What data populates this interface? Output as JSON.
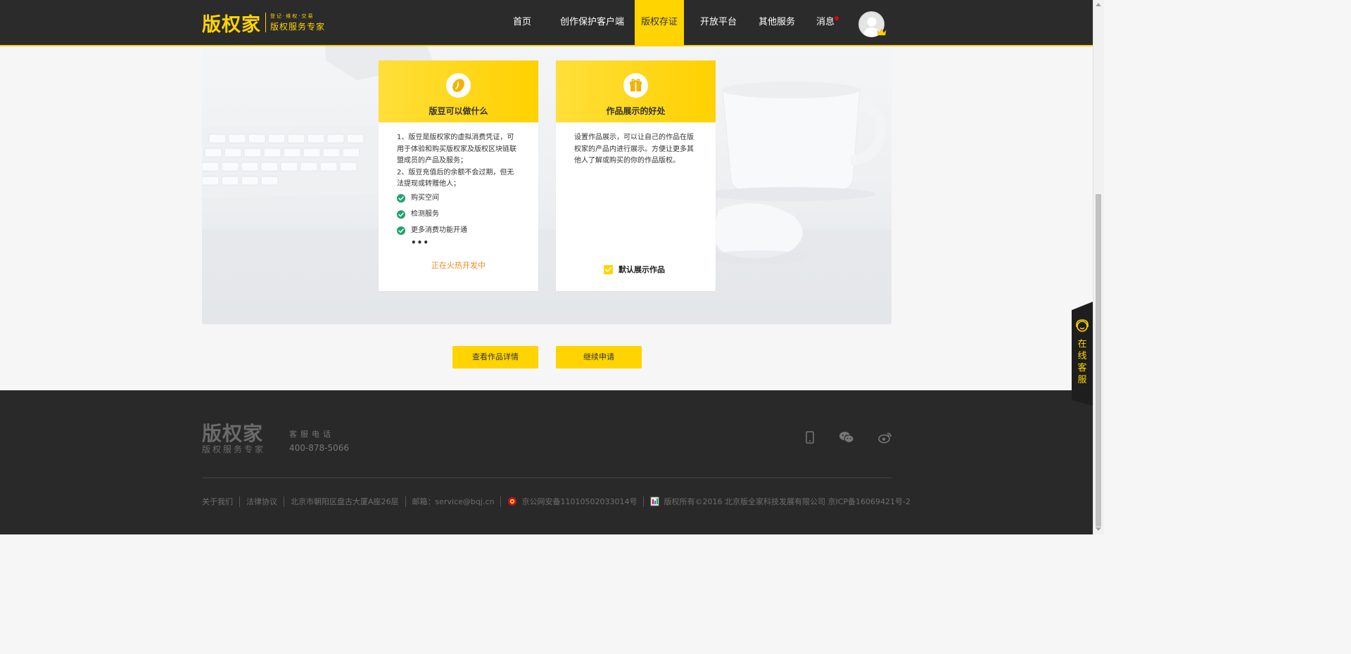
{
  "header": {
    "logo_main": "版权家",
    "logo_tag": "登记·维权·交易",
    "logo_slogan": "版权服务专家",
    "nav": [
      "首页",
      "创作保护客户端",
      "版权存证",
      "开放平台",
      "其他服务",
      "消息"
    ],
    "active_nav": "版权存证"
  },
  "cards": {
    "beans": {
      "title": "版豆可以做什么",
      "para1": "1、版豆是版权家的虚拟消费凭证，可用于体验和购买版权家及版权区块链联盟成员的产品及服务；",
      "para2": "2、版豆充值后的余额不会过期，但无法提现或转赠他人；",
      "items": [
        "购买空间",
        "检测服务",
        "更多消费功能开通"
      ],
      "dots": "•••",
      "developing": "正在火热开发中"
    },
    "showcase": {
      "title": "作品展示的好处",
      "text": "设置作品展示，可以让自己的作品在版权家的产品内进行展示。方便让更多其他人了解或购买的你的作品版权。",
      "checkbox_label": "默认展示作品"
    }
  },
  "buttons": {
    "view_details": "查看作品详情",
    "continue_apply": "继续申请"
  },
  "footer": {
    "logo_main": "版权家",
    "logo_sub": "版权服务专家",
    "service_label": "客服电话",
    "phone": "400-878-5066",
    "links": [
      "关于我们",
      "法律协议",
      "北京市朝阳区盘古大厦A座26层",
      "邮箱：service@bqj.cn",
      "京公网安备11010502033014号",
      "版权所有©2016  北京版全家科技发展有限公司  京ICP备16069421号-2"
    ]
  },
  "support": {
    "label": "在线客服"
  },
  "colors": {
    "brand_yellow": "#ffd400",
    "header_bg": "#2b2b2b",
    "footer_bg": "#292929",
    "check_green": "#21a26a",
    "developing_orange": "#f08a1c"
  },
  "icons": [
    "bean-icon",
    "gift-icon",
    "check-icon",
    "avatar-icon",
    "crown-icon",
    "mobile-icon",
    "wechat-icon",
    "weibo-icon",
    "police-badge-icon",
    "license-icon",
    "headset-icon"
  ]
}
